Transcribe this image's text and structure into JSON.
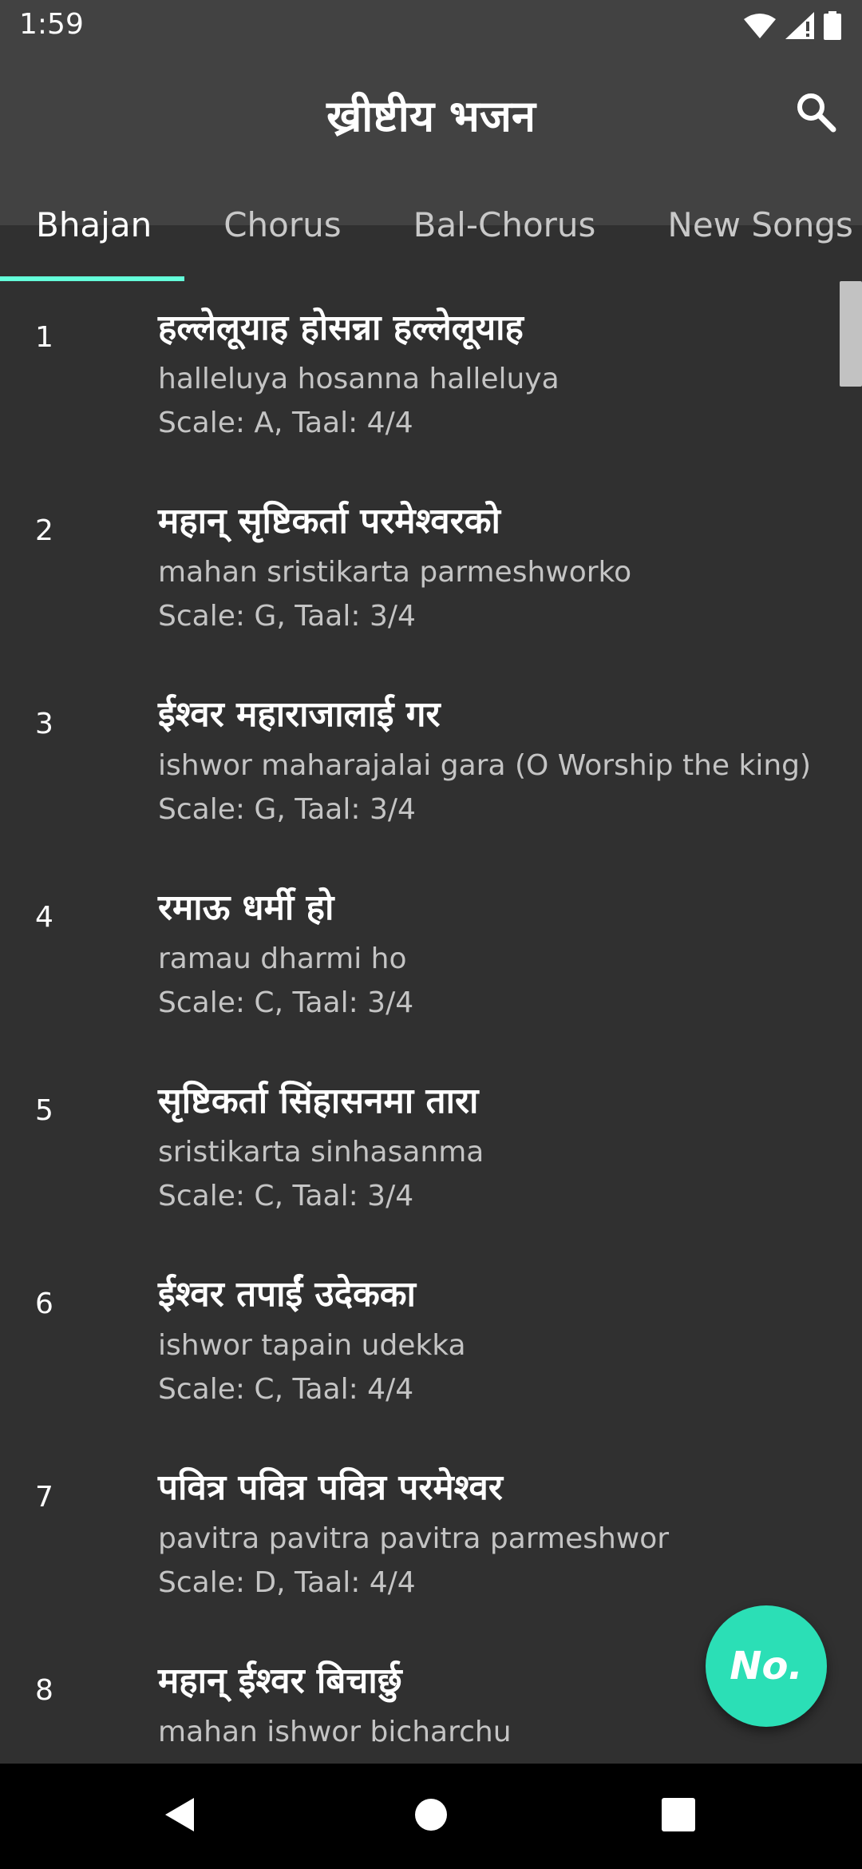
{
  "status": {
    "time": "1:59",
    "icons": [
      "wifi-icon",
      "signal-icon",
      "battery-icon"
    ]
  },
  "header": {
    "title": "ख्रीष्टीय भजन",
    "search_icon": "search-icon"
  },
  "tabs": [
    {
      "label": "Bhajan",
      "active": true
    },
    {
      "label": "Chorus",
      "active": false
    },
    {
      "label": "Bal-Chorus",
      "active": false
    },
    {
      "label": "New Songs",
      "active": false
    }
  ],
  "songs": [
    {
      "number": "1",
      "title": "हल्लेलूयाह होसन्ना हल्लेलूयाह",
      "subtitle": "halleluya hosanna halleluya",
      "meta": "Scale: A, Taal: 4/4"
    },
    {
      "number": "2",
      "title": "महान् सृष्टिकर्ता परमेश्वरको",
      "subtitle": "mahan sristikarta parmeshworko",
      "meta": "Scale: G, Taal: 3/4"
    },
    {
      "number": "3",
      "title": "ईश्वर महाराजालाई गर",
      "subtitle": "ishwor maharajalai gara (O Worship the king)",
      "meta": "Scale: G, Taal: 3/4"
    },
    {
      "number": "4",
      "title": "रमाऊ धर्मी हो",
      "subtitle": "ramau dharmi ho",
      "meta": "Scale: C, Taal: 3/4"
    },
    {
      "number": "5",
      "title": " सृष्टिकर्ता सिंहासनमा तारा",
      "subtitle": "sristikarta sinhasanma",
      "meta": "Scale: C, Taal: 3/4"
    },
    {
      "number": "6",
      "title": "ईश्वर तपाईं उदेकका",
      "subtitle": "ishwor tapain udekka",
      "meta": "Scale: C, Taal: 4/4"
    },
    {
      "number": "7",
      "title": "पवित्र पवित्र पवित्र परमेश्वर",
      "subtitle": "pavitra pavitra pavitra parmeshwor",
      "meta": "Scale: D, Taal: 4/4"
    },
    {
      "number": "8",
      "title": "महान् ईश्वर बिचार्छु",
      "subtitle": "mahan ishwor bicharchu",
      "meta": ""
    }
  ],
  "fab": {
    "label": "No."
  },
  "colors": {
    "background": "#303030",
    "appbar": "#424242",
    "accent": "#64ffda",
    "fab": "#2bdfb6"
  },
  "navbar": {
    "icons": [
      "back-icon",
      "home-icon",
      "recents-icon"
    ]
  }
}
